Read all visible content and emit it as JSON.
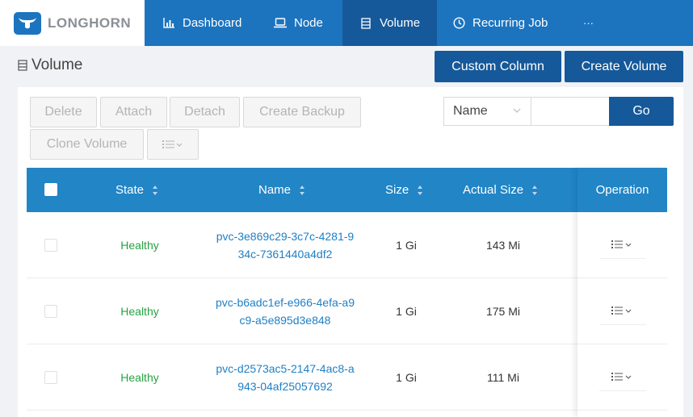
{
  "brand": {
    "name": "LONGHORN"
  },
  "nav": {
    "items": [
      {
        "label": "Dashboard",
        "icon": "bar-chart-icon"
      },
      {
        "label": "Node",
        "icon": "laptop-icon"
      },
      {
        "label": "Volume",
        "icon": "database-icon",
        "active": true
      },
      {
        "label": "Recurring Job",
        "icon": "clock-icon"
      },
      {
        "label": "···",
        "icon": "more-icon"
      }
    ]
  },
  "page": {
    "title": "Volume"
  },
  "header_buttons": {
    "custom_column": "Custom Column",
    "create_volume": "Create Volume"
  },
  "toolbar": {
    "delete": "Delete",
    "attach": "Attach",
    "detach": "Detach",
    "create_backup": "Create Backup",
    "clone_volume": "Clone Volume"
  },
  "search": {
    "field": "Name",
    "go": "Go",
    "value": ""
  },
  "table": {
    "columns": {
      "state": "State",
      "name": "Name",
      "size": "Size",
      "actual_size": "Actual Size",
      "operation": "Operation"
    },
    "rows": [
      {
        "state": "Healthy",
        "name": "pvc-3e869c29-3c7c-4281-934c-7361440a4df2",
        "size": "1 Gi",
        "actual_size": "143 Mi"
      },
      {
        "state": "Healthy",
        "name": "pvc-b6adc1ef-e966-4efa-a9c9-a5e895d3e848",
        "size": "1 Gi",
        "actual_size": "175 Mi"
      },
      {
        "state": "Healthy",
        "name": "pvc-d2573ac5-2147-4ac8-a943-04af25057692",
        "size": "1 Gi",
        "actual_size": "111 Mi"
      }
    ]
  },
  "colors": {
    "nav_bg": "#1c74bf",
    "nav_active": "#16599a",
    "table_header": "#2185c6",
    "healthy": "#27a243",
    "link": "#1f7fc4"
  }
}
